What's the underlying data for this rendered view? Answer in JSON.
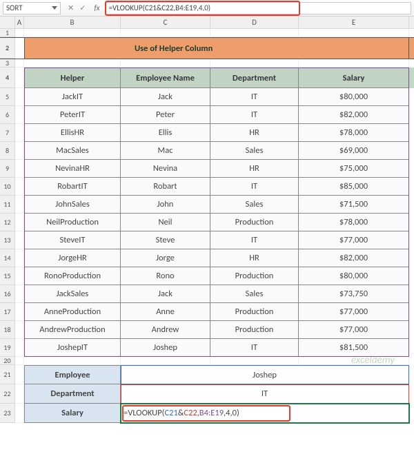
{
  "namebox": "SORT",
  "formula_bar": "=VLOOKUP(C21&C22,B4:E19,4,0)",
  "columns": [
    "A",
    "B",
    "C",
    "D",
    "E"
  ],
  "title": "Use of Helper Column",
  "headers": {
    "b": "Helper",
    "c": "Employee Name",
    "d": "Department",
    "e": "Salary"
  },
  "rows": [
    {
      "n": "5",
      "b": "JackIT",
      "c": "Jack",
      "d": "IT",
      "e": "$80,000"
    },
    {
      "n": "6",
      "b": "PeterIT",
      "c": "Peter",
      "d": "IT",
      "e": "$82,000"
    },
    {
      "n": "7",
      "b": "EllisHR",
      "c": "Ellis",
      "d": "HR",
      "e": "$78,000"
    },
    {
      "n": "8",
      "b": "MacSales",
      "c": "Mac",
      "d": "Sales",
      "e": "$69,000"
    },
    {
      "n": "9",
      "b": "NevinaHR",
      "c": "Nevina",
      "d": "HR",
      "e": "$75,000"
    },
    {
      "n": "10",
      "b": "RobartIT",
      "c": "Robart",
      "d": "IT",
      "e": "$85,000"
    },
    {
      "n": "11",
      "b": "JohnSales",
      "c": "John",
      "d": "Sales",
      "e": "$71,500"
    },
    {
      "n": "12",
      "b": "NeilProduction",
      "c": "Neil",
      "d": "Production",
      "e": "$78,000"
    },
    {
      "n": "13",
      "b": "SteveIT",
      "c": "Steve",
      "d": "IT",
      "e": "$77,000"
    },
    {
      "n": "14",
      "b": "JorgeHR",
      "c": "Jorge",
      "d": "HR",
      "e": "$82,000"
    },
    {
      "n": "15",
      "b": "RonoProduction",
      "c": "Rono",
      "d": "Production",
      "e": "$80,000"
    },
    {
      "n": "16",
      "b": "JackSales",
      "c": "Jack",
      "d": "Sales",
      "e": "$73,750"
    },
    {
      "n": "17",
      "b": "AnneProduction",
      "c": "Anne",
      "d": "Production",
      "e": "$77,000"
    },
    {
      "n": "18",
      "b": "AndrewProduction",
      "c": "Andrew",
      "d": "Production",
      "e": "$77,000"
    },
    {
      "n": "19",
      "b": "JoshepIT",
      "c": "Joshep",
      "d": "IT",
      "e": "$81,500"
    }
  ],
  "lookup": {
    "r21_label": "Employee",
    "r21_value": "Joshep",
    "r22_label": "Department",
    "r22_value": "IT",
    "r23_label": "Salary",
    "formula_prefix": "=VLOOKUP(",
    "p_c21": "C21",
    "amp": "&",
    "p_c22": "C22",
    "comma1": ",",
    "p_range": "B4:E19",
    "suffix": ",4,0)"
  },
  "row_nums": {
    "r1": "1",
    "r2": "2",
    "r3": "3",
    "r4": "4",
    "r20": "20",
    "r21": "21",
    "r22": "22",
    "r23": "23"
  },
  "watermark": "exceldemy"
}
